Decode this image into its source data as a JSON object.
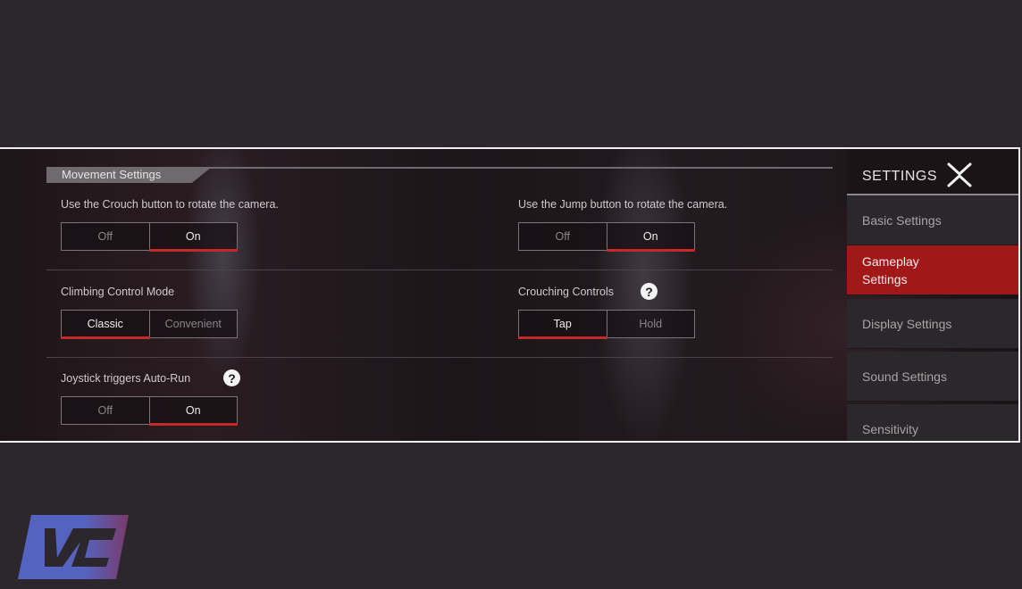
{
  "section": {
    "title": "Movement Settings"
  },
  "settings": [
    {
      "label": "Use the Crouch button to rotate the camera.",
      "options": [
        "Off",
        "On"
      ],
      "selected": "On",
      "help": false
    },
    {
      "label": "Use the Jump button to rotate the camera.",
      "options": [
        "Off",
        "On"
      ],
      "selected": "On",
      "help": false
    },
    {
      "label": "Climbing Control Mode",
      "options": [
        "Classic",
        "Convenient"
      ],
      "selected": "Classic",
      "help": false
    },
    {
      "label": "Crouching Controls",
      "options": [
        "Tap",
        "Hold"
      ],
      "selected": "Tap",
      "help": true
    },
    {
      "label": "Joystick triggers Auto-Run",
      "options": [
        "Off",
        "On"
      ],
      "selected": "On",
      "help": true
    }
  ],
  "sidebar": {
    "title": "SETTINGS",
    "close_icon": "x-close-icon",
    "items": [
      {
        "label": "Basic Settings",
        "active": false
      },
      {
        "label": "Gameplay Settings",
        "active": true
      },
      {
        "label": "Display Settings",
        "active": false
      },
      {
        "label": "Sound Settings",
        "active": false
      },
      {
        "label": "Sensitivity",
        "active": false
      }
    ]
  },
  "help_glyph": "?",
  "colors": {
    "accent_red": "#c4282a",
    "active_tab": "#a01818",
    "logo_blue": "#5060b8"
  }
}
